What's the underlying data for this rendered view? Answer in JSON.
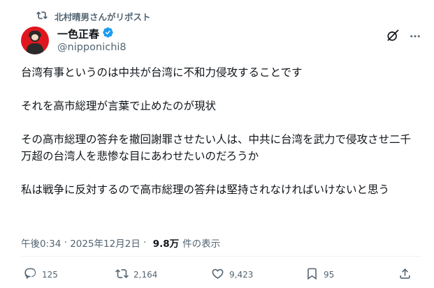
{
  "repost": {
    "label": "北村晴男さんがリポスト",
    "icon": "repost-icon"
  },
  "author": {
    "display_name": "一色正春",
    "handle": "@nipponichi8",
    "verified": true,
    "verified_color": "#1d9bf0",
    "avatar_color": "#e0161e"
  },
  "tweet": {
    "paragraphs": [
      "台湾有事というのは中共が台湾に不和力侵攻することです",
      "それを高市総理が言葉で止めたのが現状",
      "その高市総理の答弁を撤回謝罪させたい人は、中共に台湾を武力で侵攻させ二千万超の台湾人を悲惨な目にあわせたいのだろうか",
      "私は戦争に反対するので高市総理の答弁は堅持されなければいけないと思う"
    ]
  },
  "meta": {
    "time": "午後0:34",
    "separator": " · ",
    "date": "2025年12月2日",
    "separator2": " · ",
    "views_count": "9.8万",
    "views_label": "件の表示"
  },
  "actions": {
    "replies": "125",
    "reposts": "2,164",
    "likes": "9,423",
    "bookmarks": "95"
  },
  "colors": {
    "text_primary": "#0f1419",
    "text_secondary": "#536471",
    "divider": "#eff3f4"
  }
}
